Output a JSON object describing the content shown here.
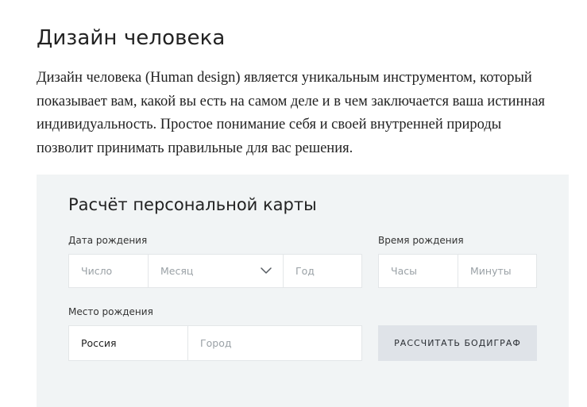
{
  "header": {
    "title": "Дизайн человека",
    "intro": "Дизайн человека (Human design) является уникальным инструментом, который показывает вам, какой вы есть на самом деле и в чем заключается ваша истинная индивидуальность. Простое понимание себя и своей внутренней природы позволит принимать правильные для вас решения."
  },
  "calculator": {
    "title": "Расчёт персональной карты",
    "birth_date": {
      "label": "Дата рождения",
      "day_placeholder": "Число",
      "month_selected": "Месяц",
      "year_placeholder": "Год"
    },
    "birth_time": {
      "label": "Время рождения",
      "hours_placeholder": "Часы",
      "minutes_placeholder": "Минуты"
    },
    "birth_place": {
      "label": "Место рождения",
      "country_value": "Россия",
      "city_placeholder": "Город"
    },
    "submit_label": "РАССЧИТАТЬ БОДИГРАФ"
  },
  "icons": {
    "month_select": "chevron-down-icon"
  },
  "colors": {
    "panel_background": "#f1f4f5",
    "button_background": "#dfe3e8",
    "input_border": "#e3e6e8",
    "placeholder": "#9aa1a6"
  }
}
